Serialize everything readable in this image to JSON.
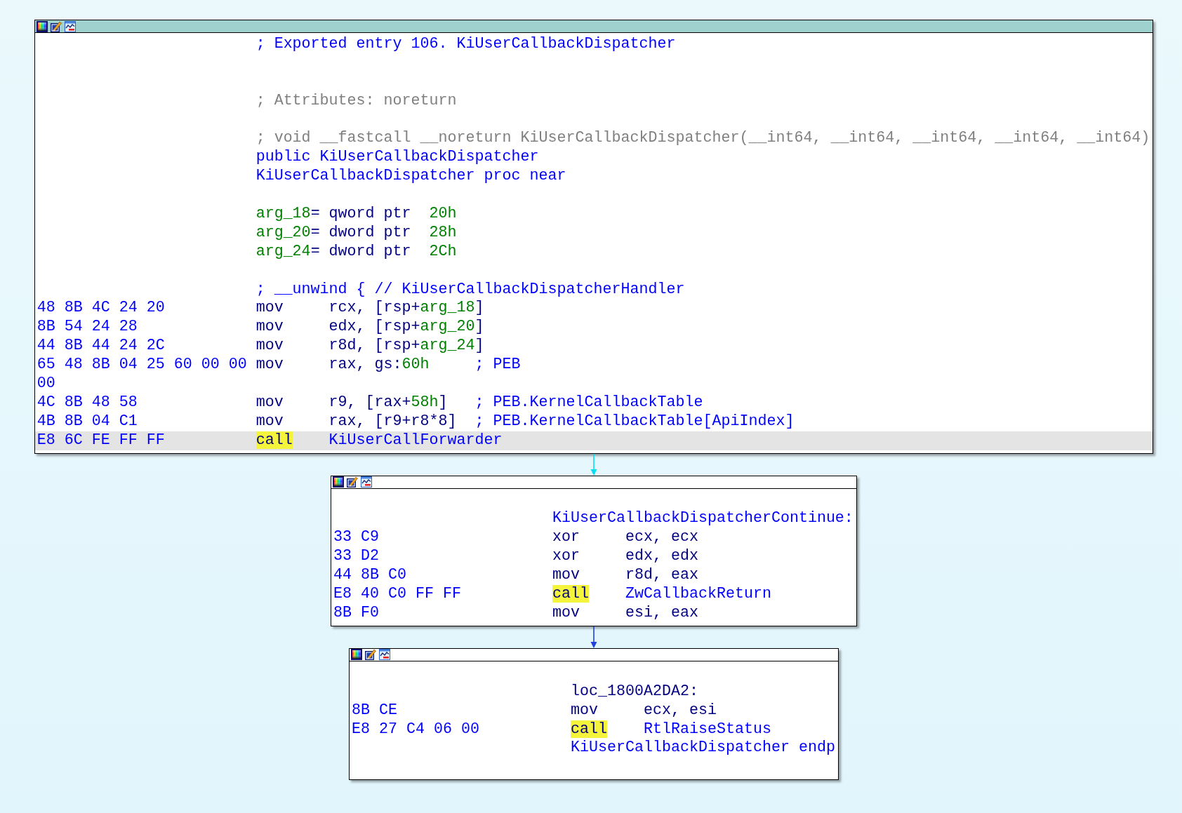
{
  "blocks": [
    {
      "selected": true,
      "lines": [
        {
          "kind": "comment",
          "selected": false,
          "content": [
            {
              "kind": "remark",
              "text": "; Exported entry 106. KiUserCallbackDispatcher"
            }
          ]
        },
        {
          "kind": "blank"
        },
        {
          "kind": "blank"
        },
        {
          "kind": "comment",
          "selected": false,
          "content": [
            {
              "kind": "comment",
              "text": "; Attributes: noreturn"
            }
          ]
        },
        {
          "kind": "blank"
        },
        {
          "kind": "comment",
          "selected": false,
          "content": [
            {
              "kind": "comment",
              "text": "; void __fastcall __noreturn KiUserCallbackDispatcher(__int64, __int64, __int64, __int64, __int64)"
            }
          ]
        },
        {
          "kind": "directive",
          "selected": false,
          "content": [
            {
              "kind": "symbol",
              "text": "public KiUserCallbackDispatcher"
            }
          ]
        },
        {
          "kind": "directive",
          "selected": false,
          "content": [
            {
              "kind": "symbol",
              "text": "KiUserCallbackDispatcher proc near"
            }
          ]
        },
        {
          "kind": "blank"
        },
        {
          "kind": "variable",
          "selected": false,
          "content": [
            {
              "kind": "value",
              "text": "arg_18"
            },
            {
              "kind": "plain",
              "text": "= qword ptr  "
            },
            {
              "kind": "value",
              "text": "20h"
            }
          ]
        },
        {
          "kind": "variable",
          "selected": false,
          "content": [
            {
              "kind": "value",
              "text": "arg_20"
            },
            {
              "kind": "plain",
              "text": "= dword ptr  "
            },
            {
              "kind": "value",
              "text": "28h"
            }
          ]
        },
        {
          "kind": "variable",
          "selected": false,
          "content": [
            {
              "kind": "value",
              "text": "arg_24"
            },
            {
              "kind": "plain",
              "text": "= dword ptr  "
            },
            {
              "kind": "value",
              "text": "2Ch"
            }
          ]
        },
        {
          "kind": "blank"
        },
        {
          "kind": "comment",
          "selected": false,
          "content": [
            {
              "kind": "remark",
              "text": "; __unwind { // KiUserCallbackDispatcherHandler"
            }
          ]
        },
        {
          "kind": "instruction",
          "selected": false,
          "bytes": "48 8B 4C 24 20",
          "mnemonic": "mov",
          "highlighted": false,
          "operands": [
            {
              "kind": "plain",
              "text": "rcx, [rsp+"
            },
            {
              "kind": "value",
              "text": "arg_18"
            },
            {
              "kind": "plain",
              "text": "]"
            }
          ]
        },
        {
          "kind": "instruction",
          "selected": false,
          "bytes": "8B 54 24 28",
          "mnemonic": "mov",
          "highlighted": false,
          "operands": [
            {
              "kind": "plain",
              "text": "edx, [rsp+"
            },
            {
              "kind": "value",
              "text": "arg_20"
            },
            {
              "kind": "plain",
              "text": "]"
            }
          ]
        },
        {
          "kind": "instruction",
          "selected": false,
          "bytes": "44 8B 44 24 2C",
          "mnemonic": "mov",
          "highlighted": false,
          "operands": [
            {
              "kind": "plain",
              "text": "r8d, [rsp+"
            },
            {
              "kind": "value",
              "text": "arg_24"
            },
            {
              "kind": "plain",
              "text": "]"
            }
          ]
        },
        {
          "kind": "instruction",
          "selected": false,
          "bytes": "65 48 8B 04 25 60 00 00",
          "mnemonic": "mov",
          "highlighted": false,
          "operands": [
            {
              "kind": "plain",
              "text": "rax, gs:"
            },
            {
              "kind": "value",
              "text": "60h"
            }
          ],
          "comment": [
            {
              "kind": "remark",
              "text": "; PEB"
            }
          ]
        },
        {
          "kind": "bytes",
          "selected": false,
          "bytes": "00"
        },
        {
          "kind": "instruction",
          "selected": false,
          "bytes": "4C 8B 48 58",
          "mnemonic": "mov",
          "highlighted": false,
          "operands": [
            {
              "kind": "plain",
              "text": "r9, [rax+"
            },
            {
              "kind": "value",
              "text": "58h"
            },
            {
              "kind": "plain",
              "text": "]"
            }
          ],
          "comment": [
            {
              "kind": "remark",
              "text": "; PEB.KernelCallbackTable"
            }
          ]
        },
        {
          "kind": "instruction",
          "selected": false,
          "bytes": "4B 8B 04 C1",
          "mnemonic": "mov",
          "highlighted": false,
          "operands": [
            {
              "kind": "plain",
              "text": "rax, [r9+r8*8]"
            }
          ],
          "comment": [
            {
              "kind": "remark",
              "text": "; PEB.KernelCallbackTable[ApiIndex]"
            }
          ]
        },
        {
          "kind": "instruction",
          "selected": true,
          "bytes": "E8 6C FE FF FF",
          "mnemonic": "call",
          "highlighted": true,
          "operands": [
            {
              "kind": "symbol",
              "text": "KiUserCallForwarder"
            }
          ]
        }
      ]
    },
    {
      "selected": false,
      "lines": [
        {
          "kind": "blank"
        },
        {
          "kind": "label",
          "selected": false,
          "content": [
            {
              "kind": "symbol",
              "text": "KiUserCallbackDispatcherContinue:"
            }
          ]
        },
        {
          "kind": "instruction",
          "selected": false,
          "bytes": "33 C9",
          "mnemonic": "xor",
          "highlighted": false,
          "operands": [
            {
              "kind": "plain",
              "text": "ecx, ecx"
            }
          ]
        },
        {
          "kind": "instruction",
          "selected": false,
          "bytes": "33 D2",
          "mnemonic": "xor",
          "highlighted": false,
          "operands": [
            {
              "kind": "plain",
              "text": "edx, edx"
            }
          ]
        },
        {
          "kind": "instruction",
          "selected": false,
          "bytes": "44 8B C0",
          "mnemonic": "mov",
          "highlighted": false,
          "operands": [
            {
              "kind": "plain",
              "text": "r8d, eax"
            }
          ]
        },
        {
          "kind": "instruction",
          "selected": false,
          "bytes": "E8 40 C0 FF FF",
          "mnemonic": "call",
          "highlighted": true,
          "operands": [
            {
              "kind": "symbol",
              "text": "ZwCallbackReturn"
            }
          ]
        },
        {
          "kind": "instruction",
          "selected": false,
          "bytes": "8B F0",
          "mnemonic": "mov",
          "highlighted": false,
          "operands": [
            {
              "kind": "plain",
              "text": "esi, eax"
            }
          ]
        }
      ]
    },
    {
      "selected": false,
      "lines": [
        {
          "kind": "blank"
        },
        {
          "kind": "label",
          "selected": false,
          "content": [
            {
              "kind": "plain",
              "text": "loc_1800A2DA2:"
            }
          ]
        },
        {
          "kind": "instruction",
          "selected": false,
          "bytes": "8B CE",
          "mnemonic": "mov",
          "highlighted": false,
          "operands": [
            {
              "kind": "plain",
              "text": "ecx, esi"
            }
          ]
        },
        {
          "kind": "instruction",
          "selected": false,
          "bytes": "E8 27 C4 06 00",
          "mnemonic": "call",
          "highlighted": true,
          "operands": [
            {
              "kind": "symbol",
              "text": "RtlRaiseStatus"
            }
          ]
        },
        {
          "kind": "directive",
          "selected": false,
          "content": [
            {
              "kind": "symbol",
              "text": "KiUserCallbackDispatcher endp"
            }
          ]
        },
        {
          "kind": "blank"
        }
      ]
    }
  ],
  "edges": [
    {
      "color": "#00e0f0"
    },
    {
      "color": "#2040e0"
    }
  ]
}
